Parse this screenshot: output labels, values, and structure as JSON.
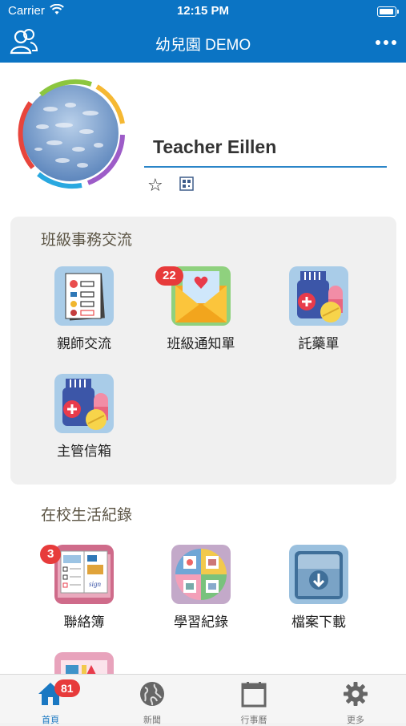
{
  "status_bar": {
    "carrier": "Carrier",
    "time": "12:15 PM"
  },
  "nav": {
    "title": "幼兒園 DEMO"
  },
  "profile": {
    "name": "Teacher Eillen"
  },
  "sections": [
    {
      "title": "班級事務交流",
      "tiles": [
        {
          "label": "親師交流",
          "badge": null,
          "icon": "checklist-icon"
        },
        {
          "label": "班級通知單",
          "badge": "22",
          "icon": "envelope-heart-icon"
        },
        {
          "label": "託藥單",
          "badge": null,
          "icon": "medicine-bottle-icon"
        },
        {
          "label": "主管信箱",
          "badge": null,
          "icon": "medicine-bottle-icon"
        }
      ]
    },
    {
      "title": "在校生活紀錄",
      "tiles": [
        {
          "label": "聯絡簿",
          "badge": "3",
          "icon": "contact-book-icon"
        },
        {
          "label": "學習紀錄",
          "badge": null,
          "icon": "learning-wheel-icon"
        },
        {
          "label": "檔案下載",
          "badge": null,
          "icon": "download-folder-icon"
        }
      ]
    }
  ],
  "tabbar": {
    "items": [
      {
        "label": "首頁",
        "icon": "home-icon",
        "badge": "81",
        "active": true
      },
      {
        "label": "新聞",
        "icon": "globe-icon",
        "badge": null,
        "active": false
      },
      {
        "label": "行事曆",
        "icon": "calendar-icon",
        "badge": null,
        "active": false
      },
      {
        "label": "更多",
        "icon": "gear-icon",
        "badge": null,
        "active": false
      }
    ]
  },
  "colors": {
    "brand_blue": "#0b74c4",
    "badge_red": "#e73b3b",
    "section_bg": "#f0f0f0"
  }
}
